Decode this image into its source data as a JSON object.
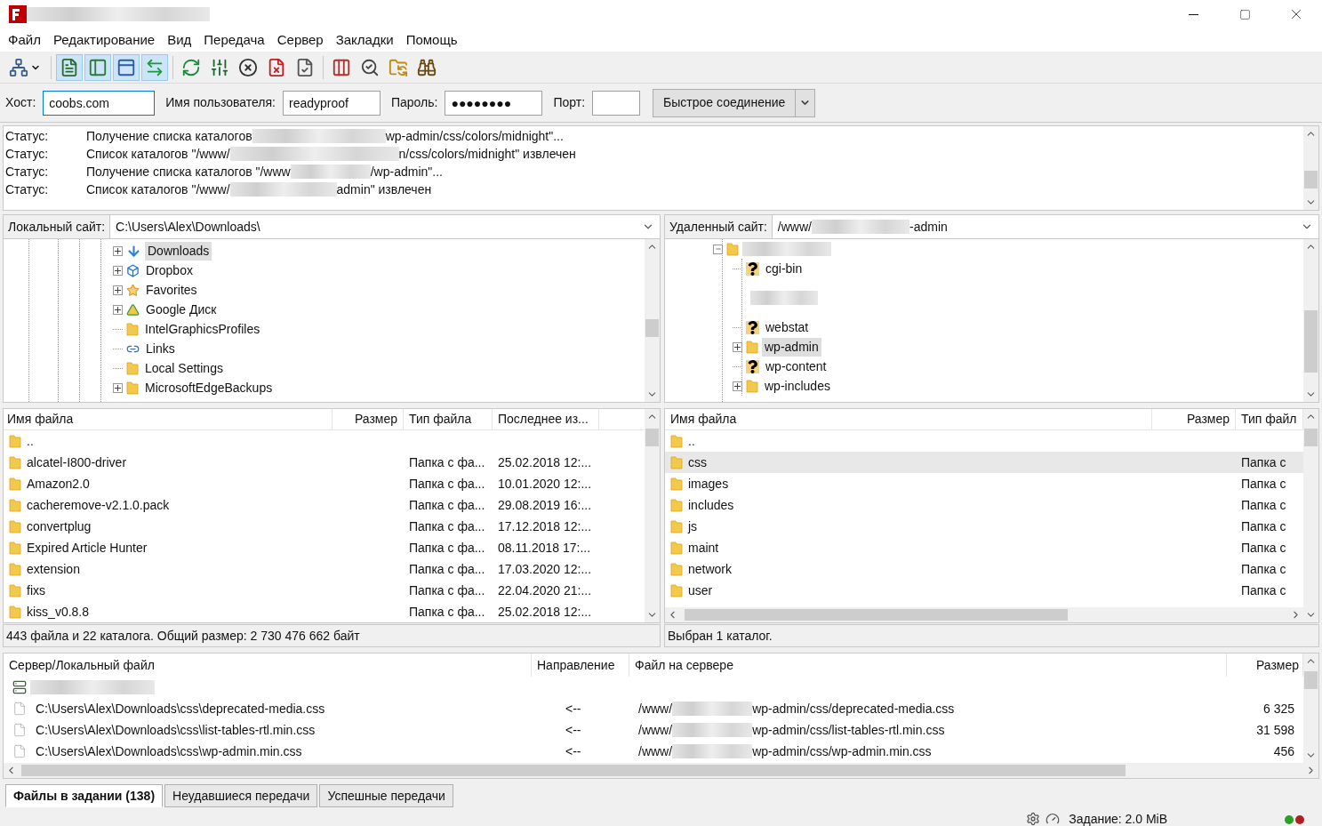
{
  "menu": [
    "Файл",
    "Редактирование",
    "Вид",
    "Передача",
    "Сервер",
    "Закладки",
    "Помощь"
  ],
  "toolbar": [
    {
      "kind": "sites",
      "on": false
    },
    {
      "kind": "log",
      "on": true
    },
    {
      "kind": "localtree",
      "on": true
    },
    {
      "kind": "remotetree",
      "on": true
    },
    {
      "kind": "queue",
      "on": true
    },
    {
      "kind": "refresh",
      "on": false
    },
    {
      "kind": "filters",
      "on": false
    },
    {
      "kind": "cancel",
      "on": false
    },
    {
      "kind": "disconnect",
      "on": false
    },
    {
      "kind": "reconnect",
      "on": false
    },
    {
      "kind": "compare",
      "on": false
    },
    {
      "kind": "search",
      "on": false
    },
    {
      "kind": "sync",
      "on": false
    },
    {
      "kind": "find",
      "on": false
    }
  ],
  "quickconnect": {
    "host_label": "Хост:",
    "host": "coobs.com",
    "user_label": "Имя пользователя:",
    "user": "readyproof",
    "pass_label": "Пароль:",
    "pass": "●●●●●●●●",
    "port_label": "Порт:",
    "button": "Быстрое соединение"
  },
  "log": [
    {
      "label": "Статус:",
      "parts": [
        "Получение списка каталогов",
        "wp-admin/css/colors/midnight\"..."
      ]
    },
    {
      "label": "Статус:",
      "parts": [
        "Список каталогов \"/www/",
        "n/css/colors/midnight\" извлечен"
      ]
    },
    {
      "label": "Статус:",
      "parts": [
        "Получение списка каталогов \"/www",
        "/wp-admin\"..."
      ]
    },
    {
      "label": "Статус:",
      "parts": [
        "Список каталогов \"/www/",
        "admin\" извлечен"
      ]
    }
  ],
  "local": {
    "label": "Локальный сайт:",
    "path": "C:\\Users\\Alex\\Downloads\\",
    "tree": [
      {
        "name": "Downloads",
        "kind": "download",
        "expandable": true,
        "selected": true
      },
      {
        "name": "Dropbox",
        "kind": "dropbox",
        "expandable": true,
        "selected": false
      },
      {
        "name": "Favorites",
        "kind": "star",
        "expandable": true,
        "selected": false
      },
      {
        "name": "Google Диск",
        "kind": "drive",
        "expandable": true,
        "selected": false
      },
      {
        "name": "IntelGraphicsProfiles",
        "kind": "folder",
        "expandable": false,
        "selected": false
      },
      {
        "name": "Links",
        "kind": "link",
        "expandable": false,
        "selected": false
      },
      {
        "name": "Local Settings",
        "kind": "folder",
        "expandable": false,
        "selected": false
      },
      {
        "name": "MicrosoftEdgeBackups",
        "kind": "folder",
        "expandable": true,
        "selected": false
      }
    ],
    "columns": [
      "Имя файла",
      "Размер",
      "Тип файла",
      "Последнее из..."
    ],
    "files": [
      {
        "name": ".."
      },
      {
        "name": "alcatel-I800-driver",
        "type": "Папка с фа...",
        "modified": "25.02.2018 12:..."
      },
      {
        "name": "Amazon2.0",
        "type": "Папка с фа...",
        "modified": "10.01.2020 12:..."
      },
      {
        "name": "cacheremove-v2.1.0.pack",
        "type": "Папка с фа...",
        "modified": "29.08.2019 16:..."
      },
      {
        "name": "convertplug",
        "type": "Папка с фа...",
        "modified": "17.12.2018 12:..."
      },
      {
        "name": "Expired Article Hunter",
        "type": "Папка с фа...",
        "modified": "08.11.2018 17:..."
      },
      {
        "name": "extension",
        "type": "Папка с фа...",
        "modified": "17.03.2020 12:..."
      },
      {
        "name": "fixs",
        "type": "Папка с фа...",
        "modified": "22.04.2020 21:..."
      },
      {
        "name": "kiss_v0.8.8",
        "type": "Папка с фа...",
        "modified": "25.02.2018 12:..."
      }
    ],
    "status": "443 файла и 22 каталога. Общий размер: 2 730 476 662 байт"
  },
  "remote": {
    "label": "Удаленный сайт:",
    "path_parts": [
      "/www/",
      "-admin"
    ],
    "tree": [
      {
        "kind": "redacted",
        "expanded": true,
        "children": [
          {
            "kind": "unknown",
            "name": "cgi-bin",
            "expandable": false,
            "selected": false
          },
          {
            "kind": "redacted"
          },
          {
            "kind": "unknown",
            "name": "webstat",
            "expandable": false,
            "selected": false
          },
          {
            "kind": "folder",
            "name": "wp-admin",
            "expandable": true,
            "selected": true
          },
          {
            "kind": "unknown",
            "name": "wp-content",
            "expandable": false,
            "selected": false
          },
          {
            "kind": "folder",
            "name": "wp-includes",
            "expandable": true,
            "selected": false
          }
        ]
      }
    ],
    "columns": [
      "Имя файла",
      "Размер",
      "Тип файл"
    ],
    "files": [
      {
        "name": "..",
        "selected": false
      },
      {
        "name": "css",
        "type": "Папка с",
        "selected": true
      },
      {
        "name": "images",
        "type": "Папка с",
        "selected": false
      },
      {
        "name": "includes",
        "type": "Папка с",
        "selected": false
      },
      {
        "name": "js",
        "type": "Папка с",
        "selected": false
      },
      {
        "name": "maint",
        "type": "Папка с",
        "selected": false
      },
      {
        "name": "network",
        "type": "Папка с",
        "selected": false
      },
      {
        "name": "user",
        "type": "Папка с",
        "selected": false
      }
    ],
    "status": "Выбран 1 каталог."
  },
  "queue": {
    "columns": [
      "Сервер/Локальный файл",
      "Направление",
      "Файл на сервере",
      "Размер"
    ],
    "rows": [
      {
        "local": "C:\\Users\\Alex\\Downloads\\css\\deprecated-media.css",
        "direction": "<--",
        "remote_parts": [
          "/www/",
          "wp-admin/css/deprecated-media.css"
        ],
        "size": "6 325"
      },
      {
        "local": "C:\\Users\\Alex\\Downloads\\css\\list-tables-rtl.min.css",
        "direction": "<--",
        "remote_parts": [
          "/www/",
          "wp-admin/css/list-tables-rtl.min.css"
        ],
        "size": "31 598"
      },
      {
        "local": "C:\\Users\\Alex\\Downloads\\css\\wp-admin.min.css",
        "direction": "<--",
        "remote_parts": [
          "/www/",
          "wp-admin/css/wp-admin.min.css"
        ],
        "size": "456"
      }
    ]
  },
  "tabs": [
    {
      "label": "Файлы в задании (138)",
      "selected": true
    },
    {
      "label": "Неудавшиеся передачи",
      "selected": false
    },
    {
      "label": "Успешные передачи",
      "selected": false
    }
  ],
  "statusbar": {
    "queue": "Задание: 2.0 MiB"
  }
}
